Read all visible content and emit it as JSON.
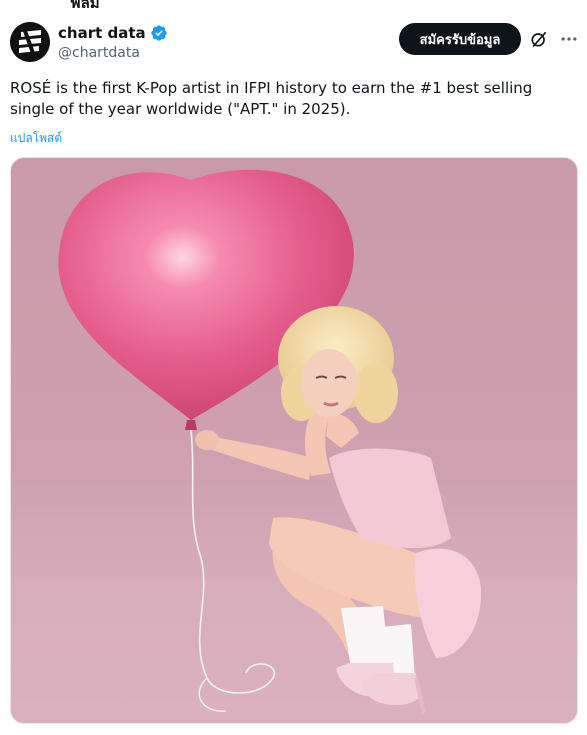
{
  "top_strip": {
    "text": "ฟิลม"
  },
  "author": {
    "display_name": "chart data",
    "handle": "@chartdata",
    "verified": true
  },
  "actions": {
    "subscribe_label": "สมัครรับข้อมูล",
    "grok_icon": "grok-icon",
    "more_icon": "more-icon"
  },
  "tweet": {
    "text": "ROSÉ is the first K-Pop artist in IFPI history to earn the #1 best selling single of the year worldwide (\"APT.\" in 2025).",
    "translate_label": "แปลโพสต์"
  },
  "colors": {
    "verified": "#1d9bf0",
    "link": "#1d9bf0",
    "button_bg": "#0f1419",
    "balloon": "#e8618f",
    "backdrop": "#cfa1b0"
  }
}
